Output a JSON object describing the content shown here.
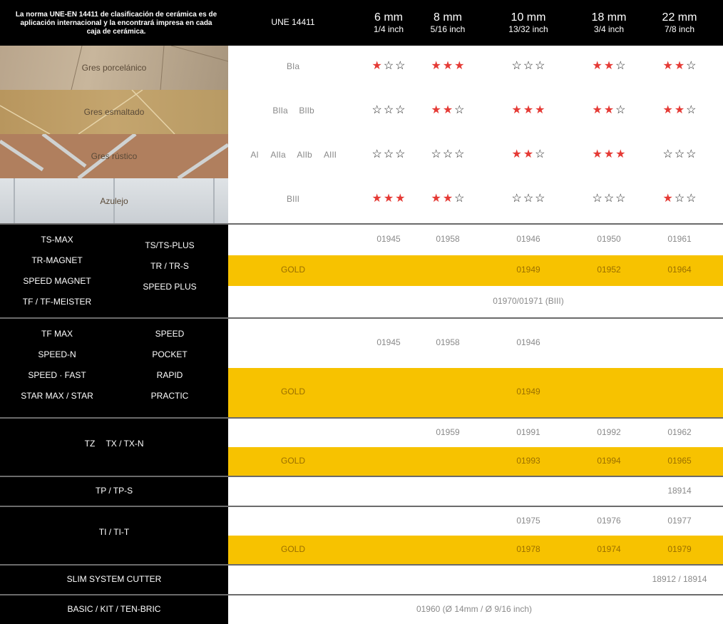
{
  "header": {
    "intro": "La norma UNE-EN 14411 de clasificación de cerámica es de aplicación internacional y la encontrará impresa en cada caja de cerámica.",
    "norm": "UNE 14411",
    "sizes": [
      {
        "mm": "6 mm",
        "inch": "1/4 inch"
      },
      {
        "mm": "8 mm",
        "inch": "5/16 inch"
      },
      {
        "mm": "10 mm",
        "inch": "13/32 inch"
      },
      {
        "mm": "18 mm",
        "inch": "3/4 inch"
      },
      {
        "mm": "22 mm",
        "inch": "7/8 inch"
      }
    ]
  },
  "tiles": [
    {
      "name": "Gres porcelánico",
      "classes": [
        "BIa"
      ],
      "ratings": [
        1,
        3,
        0,
        2,
        2
      ]
    },
    {
      "name": "Gres esmaltado",
      "classes": [
        "BIIa",
        "BIIb"
      ],
      "ratings": [
        0,
        2,
        3,
        2,
        2
      ]
    },
    {
      "name": "Gres rústico",
      "classes": [
        "AI",
        "AIIa",
        "AIIb",
        "AIII"
      ],
      "ratings": [
        0,
        0,
        2,
        3,
        0
      ]
    },
    {
      "name": "Azulejo",
      "classes": [
        "BIII"
      ],
      "ratings": [
        3,
        2,
        0,
        0,
        1
      ]
    }
  ],
  "groups": {
    "g1": {
      "left": [
        "TS-MAX",
        "TR-MAGNET",
        "SPEED MAGNET",
        "TF / TF-MEISTER"
      ],
      "right": [
        "TS/TS-PLUS",
        "TR / TR-S",
        "SPEED PLUS"
      ],
      "row1": [
        "01945",
        "01958",
        "01946",
        "01950",
        "01961"
      ],
      "gold": "GOLD",
      "row2": [
        "01949",
        "01952",
        "01964"
      ],
      "row3": "01970/01971 (BIII)"
    },
    "g2": {
      "left": [
        "TF MAX",
        "SPEED-N",
        "SPEED · FAST",
        "STAR MAX / STAR"
      ],
      "right": [
        "SPEED",
        "POCKET",
        "RAPID",
        "PRACTIC"
      ],
      "row1": [
        "01945",
        "01958",
        "01946"
      ],
      "gold": "GOLD",
      "row2": [
        "01949"
      ]
    },
    "g3": {
      "labels": [
        "TZ",
        "TX / TX-N"
      ],
      "row1": [
        "01959",
        "01991",
        "01992",
        "01962"
      ],
      "gold": "GOLD",
      "row2": [
        "01993",
        "01994",
        "01965"
      ]
    },
    "g4": {
      "label": "TP / TP-S",
      "value": "18914"
    },
    "g5": {
      "label": "TI / TI-T",
      "row1": [
        "01975",
        "01976",
        "01977"
      ],
      "gold": "GOLD",
      "row2": [
        "01978",
        "01974",
        "01979"
      ]
    },
    "g6": {
      "label": "SLIM SYSTEM CUTTER",
      "value": "18912 / 18914"
    },
    "g7": {
      "label": "BASIC / KIT / TEN-BRIC",
      "value": "01960 (Ø 14mm / Ø 9/16 inch)"
    }
  },
  "colors": {
    "star_on": "#e53a35",
    "gold_band": "#f7c200",
    "dark": "#000000"
  }
}
